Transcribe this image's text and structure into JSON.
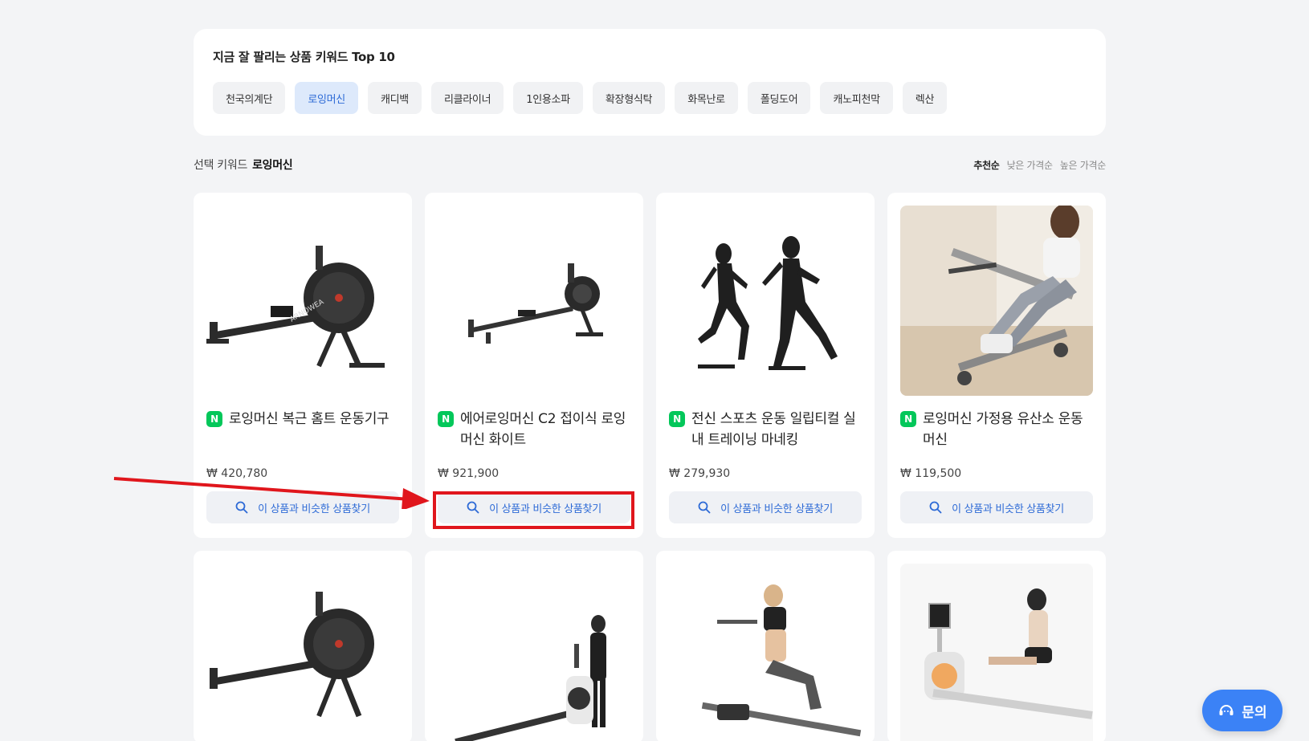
{
  "keywords": {
    "title": "지금 잘 팔리는 상품 키워드 Top 10",
    "items": [
      "천국의계단",
      "로잉머신",
      "캐디백",
      "리클라이너",
      "1인용소파",
      "확장형식탁",
      "화목난로",
      "폴딩도어",
      "캐노피천막",
      "렉산"
    ],
    "active_index": 1
  },
  "selection": {
    "label": "선택 키워드",
    "keyword": "로잉머신"
  },
  "sort": {
    "options": [
      "추천순",
      "낮은 가격순",
      "높은 가격순"
    ],
    "active": "추천순"
  },
  "products": [
    {
      "badge": "N",
      "name": "로잉머신 복근 홈트 운동기구",
      "price": "₩ 420,780",
      "button": "이 상품과 비슷한 상품찾기",
      "image": "rowing-machine-black"
    },
    {
      "badge": "N",
      "name": "에어로잉머신 C2 접이식 로잉머신 화이트",
      "price": "₩ 921,900",
      "button": "이 상품과 비슷한 상품찾기",
      "image": "air-rowing-machine"
    },
    {
      "badge": "N",
      "name": "전신 스포츠 운동 일립티컬 실내 트레이닝 마네킹",
      "price": "₩ 279,930",
      "button": "이 상품과 비슷한 상품찾기",
      "image": "running-mannequins"
    },
    {
      "badge": "N",
      "name": "로잉머신 가정용 유산소 운동 머신",
      "price": "₩ 119,500",
      "button": "이 상품과 비슷한 상품찾기",
      "image": "woman-on-rowing-machine"
    }
  ],
  "more_products": [
    {
      "image": "rowing-machine-black"
    },
    {
      "image": "woman-standing-rowing-machine"
    },
    {
      "image": "woman-rowing-machine"
    },
    {
      "image": "woman-rowing-machine-display"
    }
  ],
  "inquiry": {
    "label": "문의",
    "icon": "headset-icon"
  },
  "colors": {
    "accent": "#2d6ad6",
    "naver": "#03c75a",
    "highlight": "#e0161c",
    "inquiry": "#3b82f6"
  }
}
